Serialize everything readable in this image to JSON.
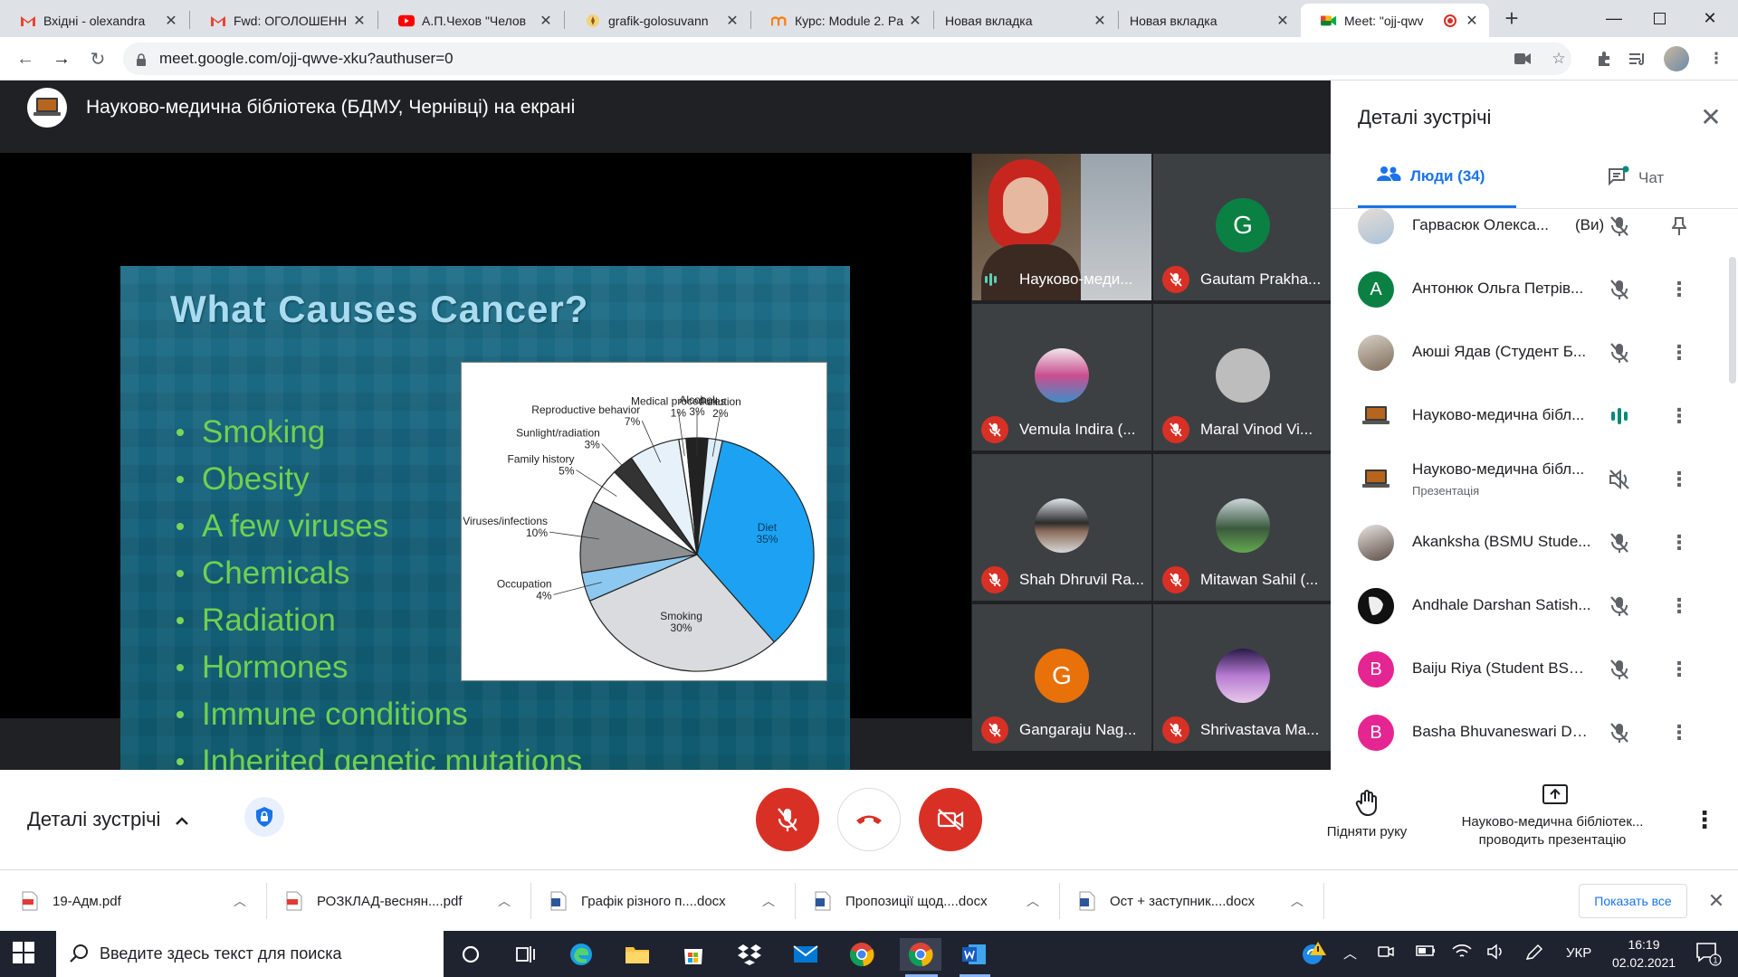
{
  "browser": {
    "tabs": [
      {
        "title": "Вхідні - olexandra",
        "icon": "gmail-icon"
      },
      {
        "title": "Fwd: ОГОЛОШЕНН",
        "icon": "gmail-icon"
      },
      {
        "title": "А.П.Чехов \"Челов",
        "icon": "youtube-icon"
      },
      {
        "title": "grafik-golosuvann",
        "icon": "site-icon"
      },
      {
        "title": "Курс: Module 2. Pa",
        "icon": "moodle-icon"
      },
      {
        "title": "Новая вкладка",
        "icon": "newtab-icon"
      },
      {
        "title": "Новая вкладка",
        "icon": "newtab-icon"
      },
      {
        "title": "Meet: \"ojj-qwv",
        "icon": "meet-icon",
        "active": true
      }
    ],
    "url": "meet.google.com/ojj-qwve-xku?authuser=0"
  },
  "meet": {
    "presenter_title": "Науково-медична бібліотека (БДМУ, Чернівці) на екрані",
    "slide": {
      "title": "What Causes Cancer?",
      "bullets": [
        "Smoking",
        "Obesity",
        "A few viruses",
        "Chemicals",
        "Radiation",
        "Hormones",
        "Immune conditions",
        "Inherited genetic mutations"
      ]
    },
    "tiles": [
      {
        "name": "Науково-меди...",
        "type": "video"
      },
      {
        "name": "Gautam Prakha...",
        "initial": "G",
        "color": "#0b8043"
      },
      {
        "name": "Vemula Indira (...",
        "type": "photo"
      },
      {
        "name": "Maral Vinod Vi...",
        "type": "blank"
      },
      {
        "name": "Shah Dhruvil Ra...",
        "type": "photo"
      },
      {
        "name": "Mitawan Sahil (...",
        "type": "photo"
      },
      {
        "name": "Gangaraju Nag...",
        "initial": "G",
        "color": "#e8710a"
      },
      {
        "name": "Shrivastava Ma...",
        "type": "photo"
      }
    ]
  },
  "chart_data": {
    "type": "pie",
    "title": "",
    "categories": [
      "Diet",
      "Smoking",
      "Occupation",
      "Viruses/infections",
      "Family history",
      "Sunlight/radiation",
      "Reproductive behavior",
      "Medical procedures",
      "Alcohol",
      "Pollution"
    ],
    "values": [
      35,
      30,
      4,
      10,
      5,
      3,
      7,
      1,
      3,
      2
    ],
    "labels": [
      "Diet\n35%",
      "Smoking\n30%",
      "Occupation\n4%",
      "Viruses/infections\n10%",
      "Family history\n5%",
      "Sunlight/radiation\n3%",
      "Reproductive behavior\n7%",
      "Medical procedures\n1%",
      "Alcohol\n3%",
      "Pollution\n2%"
    ],
    "colors": [
      "#1da1f2",
      "#d9dbde",
      "#8cc8f0",
      "#8d8f91",
      "#ffffff",
      "#333333",
      "#e6f1f9",
      "#ffffff",
      "#222222",
      "#ddeefa"
    ]
  },
  "panel": {
    "title": "Деталі зустрічі",
    "tab_people": "Люди (34)",
    "tab_chat": "Чат",
    "people": [
      {
        "name": "Гарвасюк Олекса...",
        "you": "(Ви)",
        "avatar": "photo",
        "state": "muted",
        "action": "pin"
      },
      {
        "name": "Антонюк Ольга Петрів...",
        "avatar": "initial",
        "initial": "А",
        "color": "#0b8043",
        "state": "muted"
      },
      {
        "name": "Аюші Ядав (Студент Б...",
        "avatar": "photo",
        "state": "muted"
      },
      {
        "name": "Науково-медична бібл...",
        "avatar": "laptop",
        "state": "speaking"
      },
      {
        "name": "Науково-медична бібл...",
        "sub": "Презентація",
        "avatar": "laptop",
        "state": "present-muted"
      },
      {
        "name": "Akanksha (BSMU Stude...",
        "avatar": "photo",
        "state": "muted"
      },
      {
        "name": "Andhale Darshan Satish...",
        "avatar": "photo-dark",
        "state": "muted"
      },
      {
        "name": "Baiju Riya (Student BSM...",
        "avatar": "initial",
        "initial": "B",
        "color": "#e52592",
        "state": "muted"
      },
      {
        "name": "Basha Bhuvaneswari De...",
        "avatar": "initial",
        "initial": "B",
        "color": "#e52592",
        "state": "muted"
      }
    ]
  },
  "controls": {
    "details_label": "Деталі зустрічі",
    "raise_hand": "Підняти руку",
    "presenting_line1": "Науково-медична бібліотек...",
    "presenting_line2": "проводить презентацію"
  },
  "downloads": {
    "items": [
      {
        "name": "19-Адм.pdf",
        "type": "pdf"
      },
      {
        "name": "РОЗКЛАД-веснян....pdf",
        "type": "pdf"
      },
      {
        "name": "Графік різного п....docx",
        "type": "docx"
      },
      {
        "name": "Пропозиції щод....docx",
        "type": "docx"
      },
      {
        "name": "Ост + заступник....docx",
        "type": "docx"
      }
    ],
    "show_all": "Показать все"
  },
  "taskbar": {
    "search_placeholder": "Введите здесь текст для поиска",
    "lang": "УКР",
    "time": "16:19",
    "date": "02.02.2021"
  }
}
